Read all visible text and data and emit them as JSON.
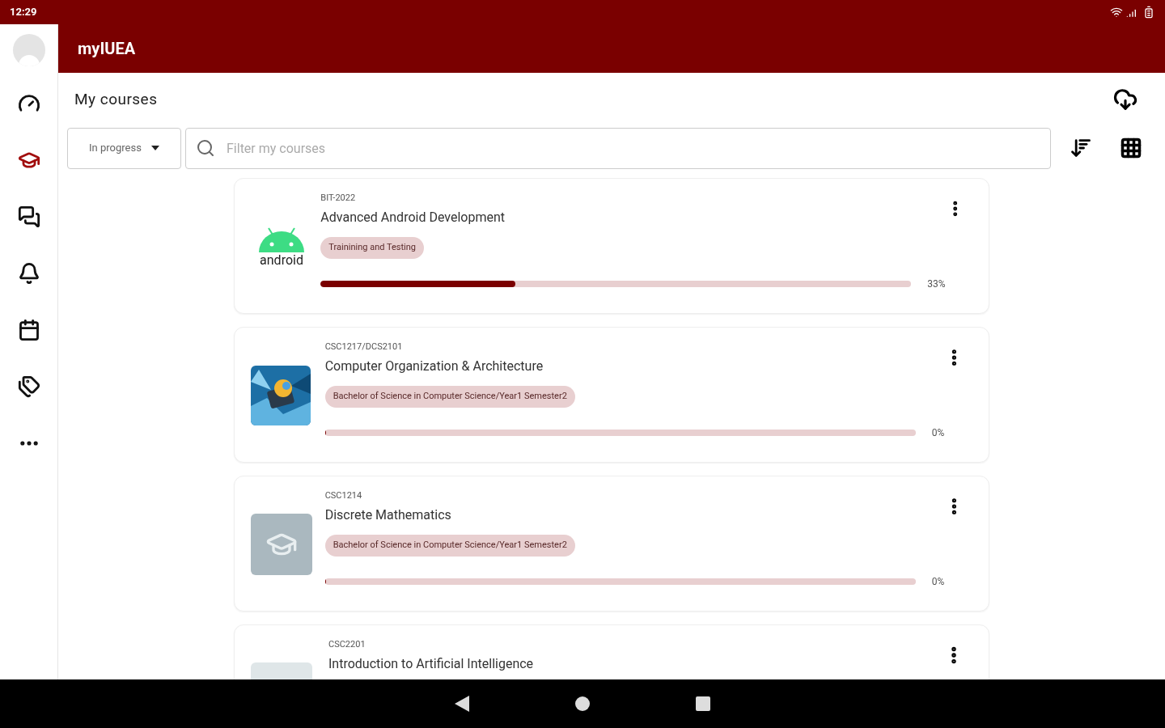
{
  "status_bar": {
    "time": "12:29"
  },
  "app_bar": {
    "title": "myIUEA"
  },
  "sidebar": {
    "items": [
      {
        "kind": "dashboard",
        "selected": false
      },
      {
        "kind": "courses",
        "selected": true
      },
      {
        "kind": "messages",
        "selected": false
      },
      {
        "kind": "notifications",
        "selected": false
      },
      {
        "kind": "calendar",
        "selected": false
      },
      {
        "kind": "tags",
        "selected": false
      },
      {
        "kind": "more",
        "selected": false
      }
    ]
  },
  "page": {
    "title": "My courses"
  },
  "filter": {
    "value": "In progress"
  },
  "search": {
    "placeholder": "Filter my courses"
  },
  "courses": [
    {
      "image": {
        "kind": "logo",
        "text": "android"
      },
      "code": "BIT-2022",
      "name": "Advanced Android Development",
      "category": "Trainining and Testing",
      "level": 0.33,
      "reading": "33%"
    },
    {
      "code": "CSC1217/DCS2101",
      "name": "Computer Organization & Architecture",
      "category": "Bachelor of Science in Computer Science/Year1 Semester2",
      "level": 0,
      "reading": "0%"
    },
    {
      "image": {
        "kind": "placeholder"
      },
      "code": "CSC1214",
      "name": "Discrete Mathematics",
      "category": "Bachelor of Science in Computer Science/Year1 Semester2",
      "level": 0,
      "reading": "0%"
    },
    {
      "image": {
        "kind": "placeholder_faded"
      },
      "code": "CSC2201",
      "name": "Introduction to Artificial Intelligence"
    }
  ]
}
